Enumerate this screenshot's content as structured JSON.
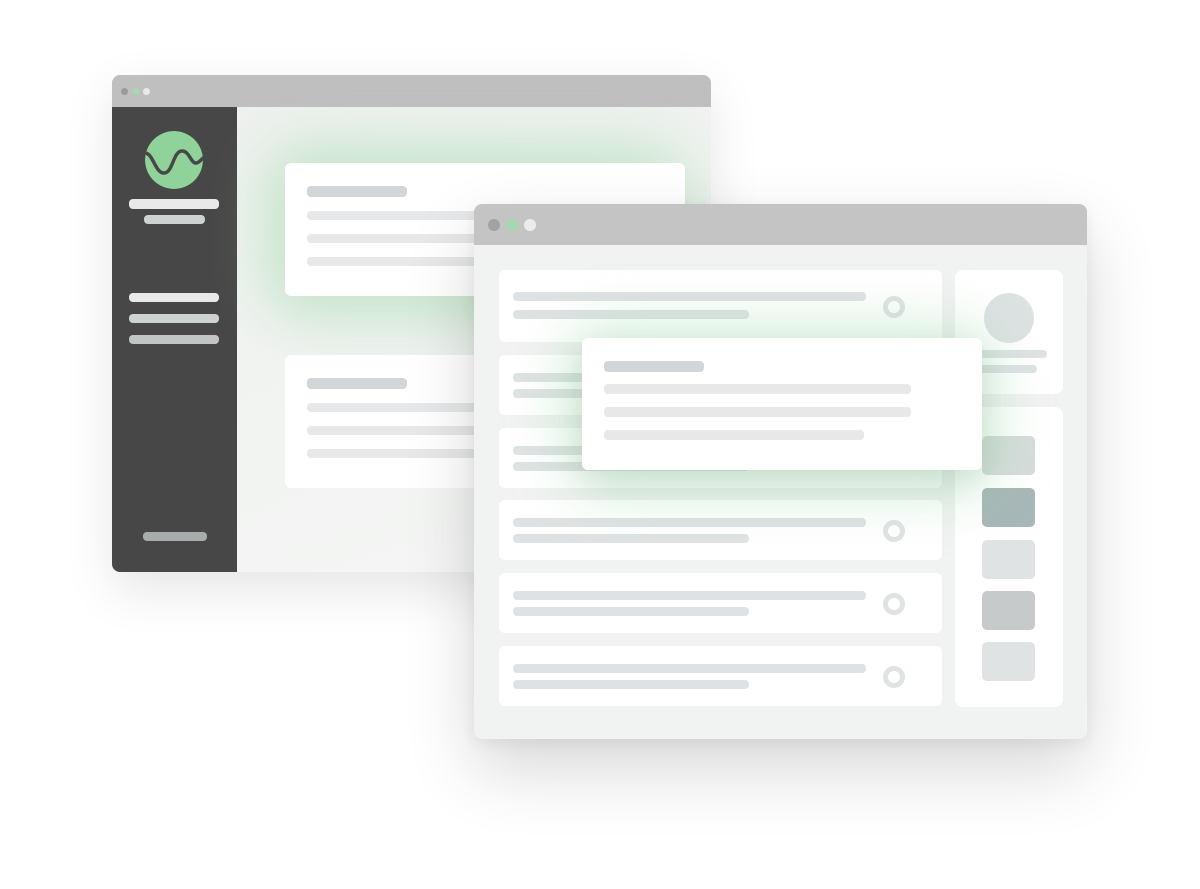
{
  "colors": {
    "accent_green": "#8fd39a",
    "sidebar_dark": "#474747",
    "titlebar_gray": "#c4c4c4",
    "window_bg": "#f1f2f2",
    "skeleton_dark": "#d3d6d8",
    "skeleton_light": "#e6e8e9"
  },
  "back_window": {
    "title_dots": [
      "#9a9a9a",
      "#a8d8ae",
      "#e9e9e9"
    ],
    "logo_icon": "wave-logo-icon"
  },
  "front_window": {
    "title_dots": [
      "#a2a2a2",
      "#a8d8ae",
      "#ececec"
    ],
    "list_row_icon": "radio-circle-icon",
    "swatches": [
      "#d6dcdb",
      "#a8b7b8",
      "#dfe3e4",
      "#c7cacb",
      "#dfe3e4"
    ],
    "avatar_icon": "avatar-placeholder-icon"
  }
}
